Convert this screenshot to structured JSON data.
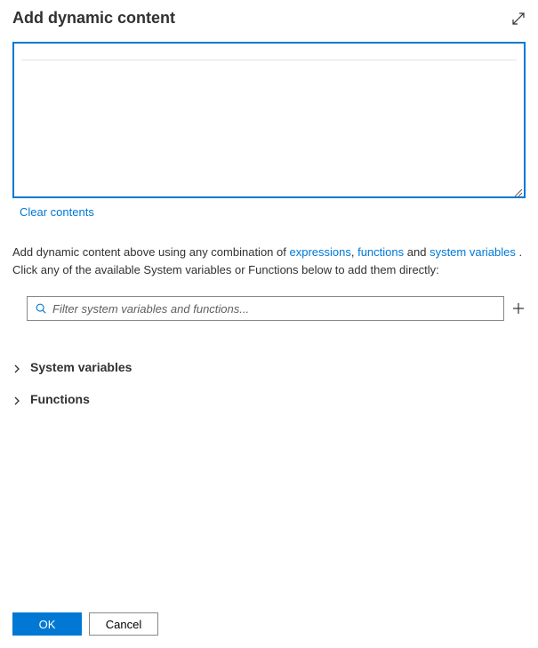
{
  "header": {
    "title": "Add dynamic content"
  },
  "editor": {
    "value": "",
    "clear_label": "Clear contents"
  },
  "help": {
    "prefix": "Add dynamic content above using any combination of ",
    "link_expressions": "expressions",
    "link_functions": "functions",
    "and_word": " and ",
    "comma": ", ",
    "link_system_variables": "system variables",
    "period": " . ",
    "line2": "Click any of the available System variables or Functions below to add them directly:"
  },
  "filter": {
    "placeholder": "Filter system variables and functions..."
  },
  "tree": {
    "items": [
      {
        "label": "System variables"
      },
      {
        "label": "Functions"
      }
    ]
  },
  "footer": {
    "ok_label": "OK",
    "cancel_label": "Cancel"
  }
}
